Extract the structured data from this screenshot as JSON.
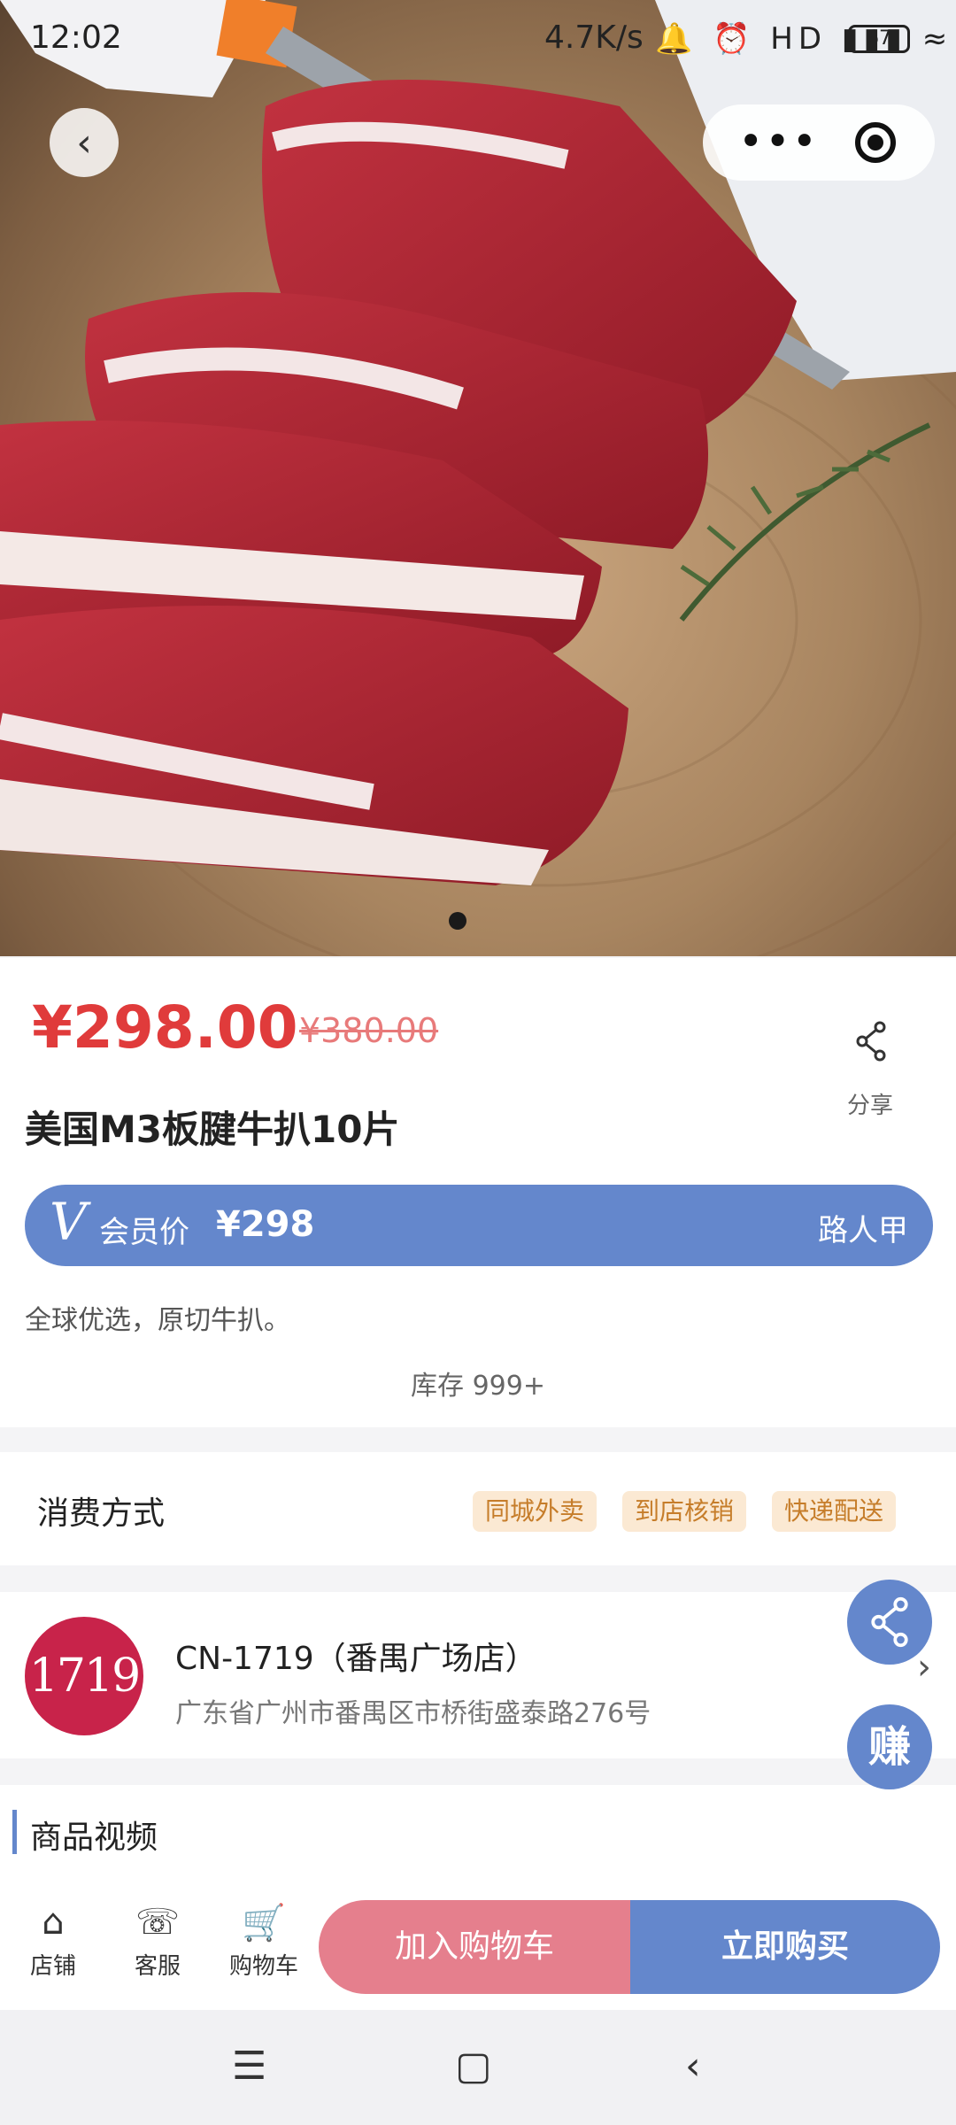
{
  "status_bar": {
    "time": "12:02",
    "net_speed": "4.7K/s",
    "icons": "🔔 ⏰ HD ▮▮▮ ≈",
    "battery": "67"
  },
  "nav": {
    "back_icon": "chevron-left-icon",
    "more_icon": "more-icon",
    "capsule_icon": "target-icon"
  },
  "product": {
    "price": "¥298.00",
    "original_price": "¥380.00",
    "share_label": "分享",
    "title": "美国M3板腱牛扒10片",
    "member_badge": "V",
    "member_label": "会员价",
    "member_price": "¥298",
    "member_level": "路人甲",
    "description": "全球优选，原切牛扒。",
    "stock": "库存 999+"
  },
  "consumption": {
    "heading": "消费方式",
    "tags": [
      "同城外卖",
      "到店核销",
      "快递配送"
    ]
  },
  "store": {
    "logo_text": "1719",
    "name": "CN-1719（番禺广场店）",
    "address": "广东省广州市番禺区市桥街盛泰路276号"
  },
  "section_video": {
    "label": "商品视频"
  },
  "floating": {
    "share_icon": "share-icon",
    "earn_label": "赚"
  },
  "bottom_bar": {
    "tabs": [
      {
        "label": "店铺",
        "icon": "shop-icon"
      },
      {
        "label": "客服",
        "icon": "service-icon"
      },
      {
        "label": "购物车",
        "icon": "cart-icon"
      }
    ],
    "add_cart": "加入购物车",
    "buy_now": "立即购买"
  },
  "colors": {
    "price_red": "#e03b3b",
    "accent_blue": "#6487cc",
    "cart_pink": "#e57f8d",
    "tag_bg": "#fbe9d3"
  }
}
